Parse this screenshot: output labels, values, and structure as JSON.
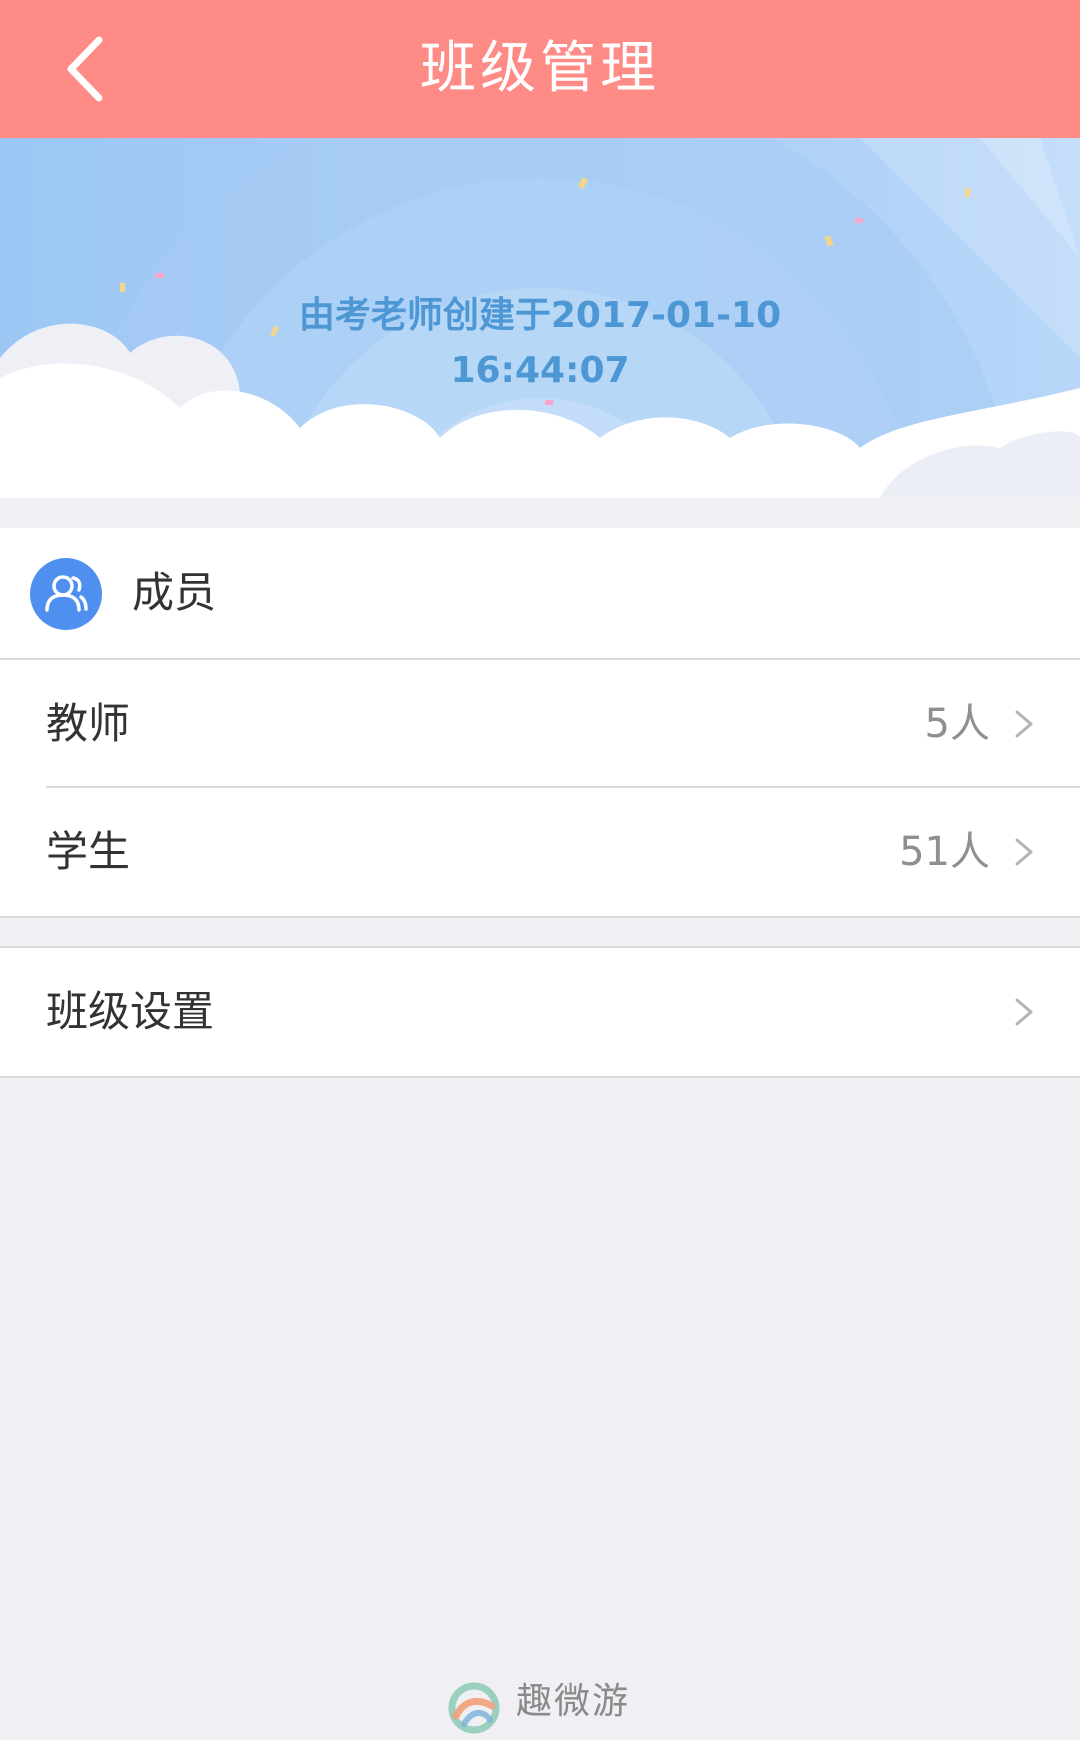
{
  "header": {
    "title": "班级管理"
  },
  "banner": {
    "created_line": "由考老师创建于2017-01-10",
    "created_time": "16:44:07"
  },
  "members": {
    "title": "成员",
    "rows": [
      {
        "label": "教师",
        "count": "5人"
      },
      {
        "label": "学生",
        "count": "51人"
      }
    ]
  },
  "settings": {
    "label": "班级设置"
  },
  "watermark": {
    "text": "趣微游"
  },
  "colors": {
    "header_bg": "#fe8b86",
    "accent_blue": "#4f8ff0",
    "banner_text": "#4c97d4",
    "page_bg": "#efeff4"
  },
  "icons": {
    "back": "chevron-left-icon",
    "members": "users-icon",
    "row_arrow": "chevron-right-icon"
  }
}
